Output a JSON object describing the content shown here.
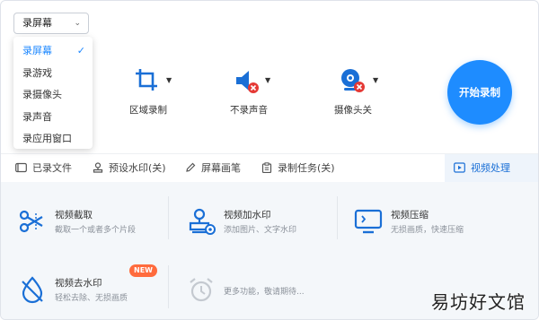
{
  "mode_select": {
    "value": "录屏幕"
  },
  "dropdown": {
    "items": [
      {
        "label": "录屏幕",
        "selected": true
      },
      {
        "label": "录游戏"
      },
      {
        "label": "录摄像头"
      },
      {
        "label": "录声音"
      },
      {
        "label": "录应用窗口"
      }
    ],
    "check": "✓"
  },
  "controls": {
    "region": {
      "label": "区域录制",
      "icon": "crop-icon"
    },
    "sound": {
      "label": "不录声音",
      "icon": "speaker-muted-icon"
    },
    "camera": {
      "label": "摄像头关",
      "icon": "webcam-off-icon"
    },
    "start": {
      "label": "开始录制"
    }
  },
  "toolbar": {
    "recorded": "已录文件",
    "watermark": "预设水印(关)",
    "brush": "屏幕画笔",
    "task": "录制任务(关)",
    "video_tools": "视频处理"
  },
  "tools": [
    {
      "title": "视频截取",
      "sub": "截取一个或者多个片段",
      "icon": "scissors-icon"
    },
    {
      "title": "视频加水印",
      "sub": "添加图片、文字水印",
      "icon": "stamp-icon"
    },
    {
      "title": "视频压缩",
      "sub": "无损画质，快速压缩",
      "icon": "compress-icon"
    },
    {
      "title": "视频去水印",
      "sub": "轻松去除、无损画质",
      "icon": "erase-watermark-icon",
      "badge": "NEW"
    },
    {
      "title": "",
      "sub": "更多功能，敬请期待...",
      "icon": "alarm-clock-icon"
    }
  ],
  "colors": {
    "accent": "#1e8cff",
    "icon_blue": "#1a6fd6",
    "mute_red": "#e53935",
    "badge": "#ff6b3d"
  },
  "watermark_text": "易坊好文馆"
}
